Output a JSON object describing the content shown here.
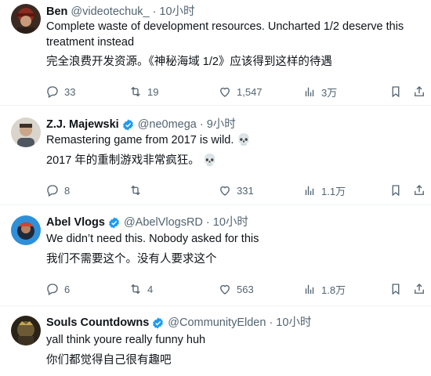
{
  "tweets": [
    {
      "name": "Ben",
      "handle": "@videotechuk_",
      "sep": "·",
      "time": "10小时",
      "verified": false,
      "text_en": "Complete waste of development resources. Uncharted 1/2 deserve this treatment instead",
      "text_zh": "完全浪费开发资源。《神秘海域 1/2》应该得到这样的待遇",
      "replies": "33",
      "retweets": "19",
      "likes": "1,547",
      "views": "3万"
    },
    {
      "name": "Z.J. Majewski",
      "handle": "@ne0mega",
      "sep": "·",
      "time": "9小时",
      "verified": true,
      "text_en": "Remastering game from 2017 is wild. 💀",
      "text_zh": "2017 年的重制游戏非常疯狂。 💀",
      "replies": "8",
      "retweets": "",
      "likes": "331",
      "views": "1.1万"
    },
    {
      "name": "Abel Vlogs",
      "handle": "@AbelVlogsRD",
      "sep": "·",
      "time": "10小时",
      "verified": true,
      "text_en": "We didn’t need this. Nobody asked for this",
      "text_zh": "我们不需要这个。没有人要求这个",
      "replies": "6",
      "retweets": "4",
      "likes": "563",
      "views": "1.8万"
    },
    {
      "name": "Souls Countdowns",
      "handle": "@CommunityElden",
      "sep": "·",
      "time": "10小时",
      "verified": true,
      "text_en": "yall think youre really funny huh",
      "text_zh": "你们都觉得自己很有趣吧"
    }
  ],
  "colors": {
    "accent": "#1d9bf0",
    "muted": "#536471",
    "divider": "#eff3f4"
  }
}
